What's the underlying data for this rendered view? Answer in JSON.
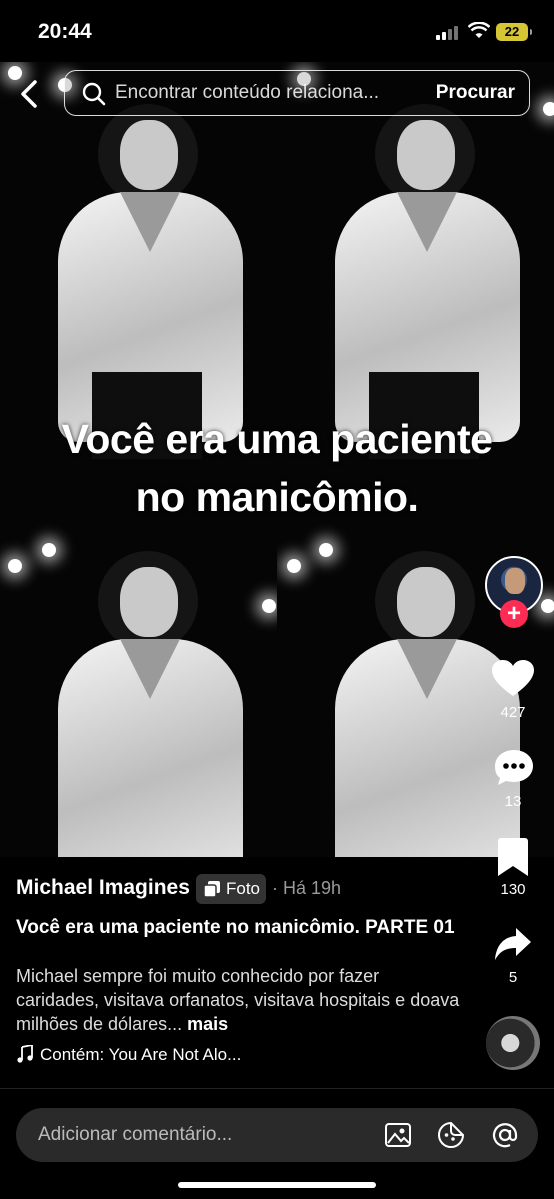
{
  "status_bar": {
    "time": "20:44",
    "battery": "22"
  },
  "search": {
    "placeholder": "Encontrar conteúdo relaciona...",
    "button_label": "Procurar"
  },
  "post": {
    "overlay_line1": "Você era uma paciente",
    "overlay_line2": "no manicômio.",
    "author": "Michael Imagines",
    "type_badge": "Foto",
    "time_ago": "· Há 19h",
    "title": "Você era uma paciente no manicômio. PARTE 01",
    "description": "Michael sempre foi muito conhecido por fazer caridades, visitava orfanatos, visitava hospitais e doava milhões de dólares...",
    "more_label": "mais",
    "music": "Contém: You Are Not Alo..."
  },
  "actions": {
    "likes": "427",
    "comments": "13",
    "saves": "130",
    "shares": "5",
    "follow_icon": "plus-icon"
  },
  "comment_bar": {
    "placeholder": "Adicionar comentário..."
  },
  "colors": {
    "follow": "#fe2c55",
    "battery": "#d6c534"
  }
}
